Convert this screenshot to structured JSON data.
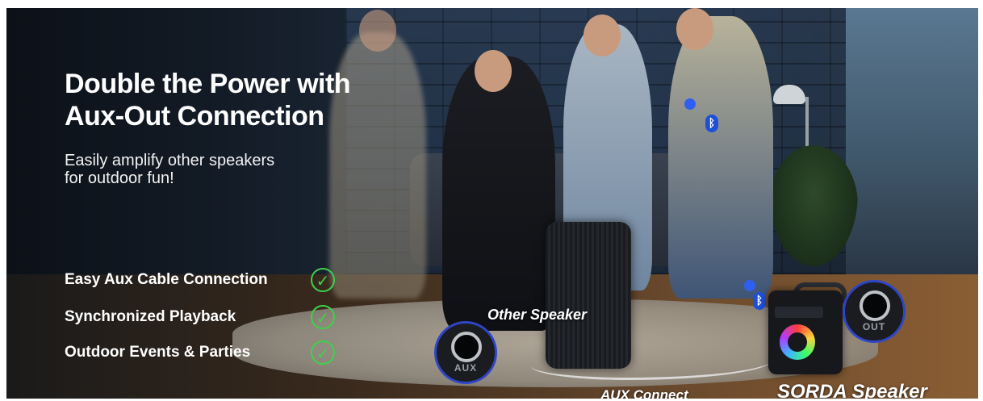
{
  "banner": {
    "headline_line1": "Double the Power with",
    "headline_line2": "Aux-Out Connection",
    "subhead_line1": "Easily amplify other speakers",
    "subhead_line2": "for outdoor fun!"
  },
  "features": [
    {
      "label": "Easy Aux Cable Connection",
      "icon": "check-circle-icon"
    },
    {
      "label": "Synchronized Playback",
      "icon": "check-circle-icon"
    },
    {
      "label": "Outdoor Events & Parties",
      "icon": "check-circle-icon"
    }
  ],
  "captions": {
    "other_speaker": "Other Speaker",
    "aux_connect": "AUX Connect",
    "sorda_speaker": "SORDA Speaker"
  },
  "ports": {
    "aux_label": "AUX",
    "out_label": "OUT"
  },
  "icons": {
    "check_glyph": "✓",
    "bluetooth_glyph": "ᛒ"
  },
  "colors": {
    "accent_green": "#3fd14a",
    "port_ring_blue": "#2e45c8",
    "bluetooth_blue": "#1e4fd8",
    "text_white": "#ffffff"
  }
}
